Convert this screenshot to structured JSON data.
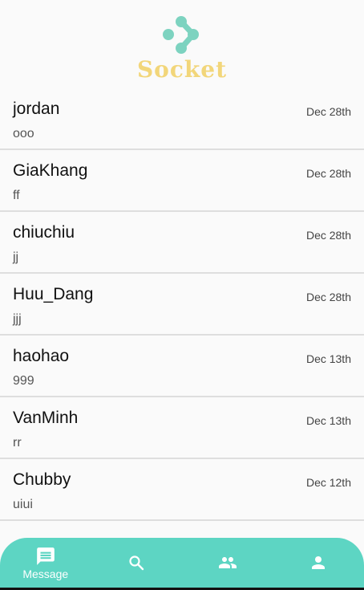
{
  "brand": "Socket",
  "colors": {
    "accent": "#5dd5c3",
    "brand_text": "#f2d67a",
    "logo": "#7dd3c0"
  },
  "conversations": [
    {
      "name": "jordan",
      "message": "ooo",
      "date": "Dec 28th"
    },
    {
      "name": "GiaKhang",
      "message": "ff",
      "date": "Dec 28th"
    },
    {
      "name": "chiuchiu",
      "message": "jj",
      "date": "Dec 28th"
    },
    {
      "name": "Huu_Dang",
      "message": "jjj",
      "date": "Dec 28th"
    },
    {
      "name": "haohao",
      "message": "999",
      "date": "Dec 13th"
    },
    {
      "name": "VanMinh",
      "message": "rr",
      "date": "Dec 13th"
    },
    {
      "name": "Chubby",
      "message": "uiui",
      "date": "Dec 12th"
    }
  ],
  "nav": [
    {
      "icon": "message-icon",
      "label": "Message",
      "active": true
    },
    {
      "icon": "search-icon"
    },
    {
      "icon": "people-icon"
    },
    {
      "icon": "person-icon"
    }
  ]
}
